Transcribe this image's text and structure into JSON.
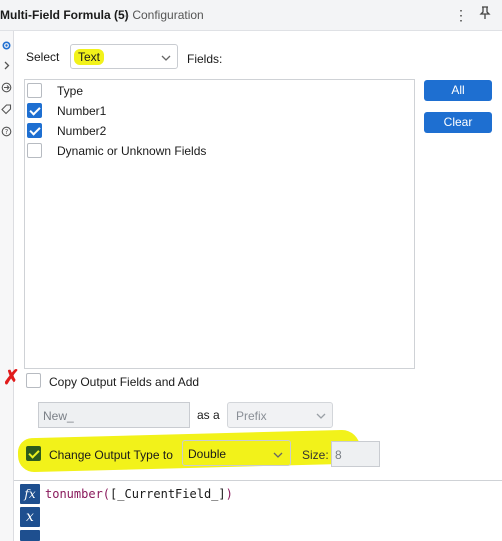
{
  "window": {
    "title_strong": "Multi-Field Formula (5)",
    "title_rest": "- Configuration",
    "more_icon": "⋮",
    "pin_icon": "pin-icon"
  },
  "left_rail": {
    "icons": [
      "gear-icon",
      "chevron-right-icon",
      "arrows-icon",
      "tag-icon",
      "help-icon"
    ]
  },
  "select": {
    "label": "Select",
    "value": "Text",
    "fields_label": "Fields:"
  },
  "field_list": [
    {
      "label": "Type",
      "checked": false
    },
    {
      "label": "Number1",
      "checked": true
    },
    {
      "label": "Number2",
      "checked": true
    },
    {
      "label": "Dynamic or Unknown Fields",
      "checked": false
    }
  ],
  "buttons": {
    "all": "All",
    "clear": "Clear"
  },
  "copy_output": {
    "label": "Copy Output Fields and Add",
    "checked": false,
    "name_value": "New_",
    "as_a": "as a",
    "position_value": "Prefix"
  },
  "change_output": {
    "label": "Change Output Type to",
    "checked": true,
    "type_value": "Double",
    "size_label": "Size:",
    "size_value": "8"
  },
  "expression": {
    "func": "tonumber(",
    "field": "[_CurrentField_]",
    "close": ")"
  },
  "annotations": {
    "red_mark": "✗",
    "highlight_color": "#f2f21a",
    "accent_color": "#1e6fd1"
  }
}
